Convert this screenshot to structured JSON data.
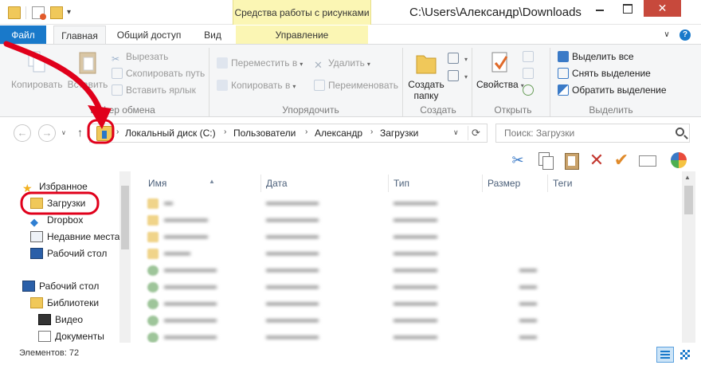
{
  "window": {
    "title": "C:\\Users\\Александр\\Downloads",
    "tools_context": "Средства работы с рисунками",
    "close_glyph": "✕",
    "help_glyph": "?",
    "dropdown_glyph": "▾",
    "collapse_glyph": "∨"
  },
  "tabs": {
    "file": "Файл",
    "home": "Главная",
    "share": "Общий доступ",
    "view": "Вид",
    "manage": "Управление"
  },
  "ribbon": {
    "clipboard": {
      "label": "Буфер обмена",
      "copy": "Копировать",
      "paste": "Вставить",
      "cut": "Вырезать",
      "copy_path": "Скопировать путь",
      "paste_shortcut": "Вставить ярлык"
    },
    "organize": {
      "label": "Упорядочить",
      "move_to": "Переместить в",
      "copy_to": "Копировать в",
      "delete": "Удалить",
      "rename": "Переименовать"
    },
    "new": {
      "label": "Создать",
      "new_folder": "Создать папку"
    },
    "open": {
      "label": "Открыть",
      "properties": "Свойства"
    },
    "select": {
      "label": "Выделить",
      "select_all": "Выделить все",
      "select_none": "Снять выделение",
      "invert": "Обратить выделение"
    }
  },
  "nav": {
    "back": "←",
    "forward": "→",
    "recent": "∨",
    "up": "↑",
    "refresh": "⟳",
    "addr_dropdown": "∨",
    "crumb_sep": "›",
    "breadcrumb": [
      "Локальный диск (C:)",
      "Пользователи",
      "Александр",
      "Загрузки"
    ]
  },
  "search": {
    "placeholder": "Поиск: Загрузки"
  },
  "toolbar": {
    "cut_glyph": "✂",
    "delete_glyph": "✕",
    "apply_glyph": "✔"
  },
  "navpane": {
    "favorites": "Избранное",
    "downloads": "Загрузки",
    "dropbox": "Dropbox",
    "recent": "Недавние места",
    "desktop_fav": "Рабочий стол",
    "desktop": "Рабочий стол",
    "libraries": "Библиотеки",
    "video": "Видео",
    "documents": "Документы"
  },
  "filelist": {
    "columns": {
      "name": "Имя",
      "date": "Дата",
      "type": "Тип",
      "size": "Размер",
      "tags": "Теги"
    },
    "sort_glyph": "▲",
    "scroll_up_glyph": "▲"
  },
  "status": {
    "count": "Элементов: 72"
  },
  "colors": {
    "accent": "#1979ca",
    "context_tab": "#fbf6b4",
    "close": "#c7493c",
    "annotation": "#e0001b"
  }
}
